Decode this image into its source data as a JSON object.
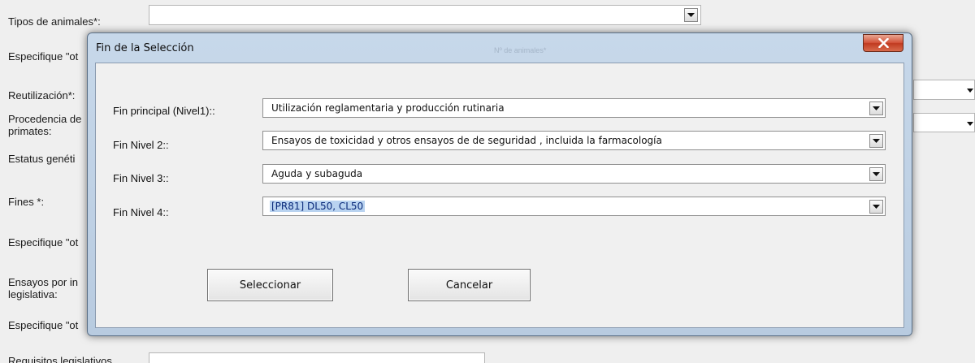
{
  "background_form": {
    "labels": {
      "tipos": "Tipos de animales*:",
      "especifique_1": "Especifique \"ot",
      "reutilizacion": "Reutilización*:",
      "procedencia_1": "Procedencia de",
      "procedencia_2": "primates:",
      "estatus": "Estatus genéti",
      "fines": "Fines *:",
      "especifique_2": "Especifique \"ot",
      "ensayos_1": "Ensayos por in",
      "ensayos_2": "legislativa:",
      "especifique_3": "Especifique \"ot",
      "requisitos": "Requisitos legislativos"
    },
    "faded_header": "Nº de animales*"
  },
  "dialog": {
    "title": "Fin de la Selección",
    "fields": [
      {
        "label": "Fin principal (Nivel1)::",
        "value": "Utilización reglamentaria y producción rutinaria"
      },
      {
        "label": "Fin Nivel 2::",
        "value": "Ensayos de toxicidad y otros ensayos de de seguridad , incluida la farmacología"
      },
      {
        "label": "Fin Nivel 3::",
        "value": "Aguda y subaguda"
      },
      {
        "label": "Fin Nivel 4::",
        "value": "[PR81] DL50, CL50"
      }
    ],
    "buttons": {
      "select": "Seleccionar",
      "cancel": "Cancelar"
    }
  },
  "icons": {
    "close": "close-icon",
    "dropdown": "chevron-down-icon"
  },
  "colors": {
    "close_button": "#c8452a",
    "selection_highlight": "#b9d3f0",
    "dialog_frame": "#bfd1e5"
  }
}
